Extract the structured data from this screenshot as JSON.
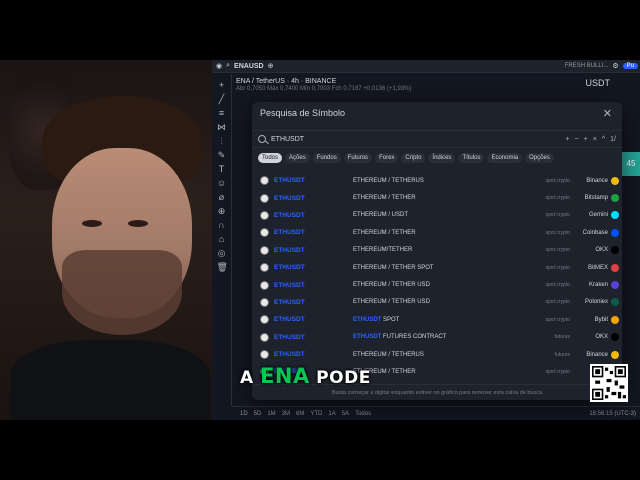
{
  "app": {
    "symbol": "ENAUSD",
    "chart_title": "ENA / TetherUS · 4h · BINANCE",
    "ohlc": "Abr 0,7050  Máx 0,7400  Mín 0,7003  Fch 0,7187 +0,0136 (+1,93%)",
    "fresh_label": "FRESH BULLI...",
    "publish_label": "Pu",
    "currency": "USDT",
    "price_tag": "45",
    "timeframes": [
      "1D",
      "5D",
      "1M",
      "3M",
      "6M",
      "YTD",
      "1A",
      "5A",
      "Todos"
    ],
    "clock": "18:56:15 (UTC-3)"
  },
  "modal": {
    "title": "Pesquisa de Símbolo",
    "search_value": "ETHUSDT",
    "search_tools": [
      "+",
      "−",
      "+",
      "×",
      "^",
      "1/"
    ],
    "tabs": [
      "Todos",
      "Ações",
      "Fundos",
      "Futuros",
      "Forex",
      "Cripto",
      "Índices",
      "Títulos",
      "Economia",
      "Opções"
    ],
    "rows": [
      {
        "symbol": "ETHUSDT",
        "desc": "ETHEREUM / TETHERUS",
        "type": "spot crypto",
        "exchange": "Binance",
        "ecolor": "#f0b90b"
      },
      {
        "symbol": "ETHUSDT",
        "desc": "ETHEREUM / TETHER",
        "type": "spot crypto",
        "exchange": "Bitstamp",
        "ecolor": "#1aa33e"
      },
      {
        "symbol": "ETHUSDT",
        "desc": "ETHEREUM / USDT",
        "type": "spot crypto",
        "exchange": "Gemini",
        "ecolor": "#00dcfa"
      },
      {
        "symbol": "ETHUSDT",
        "desc": "ETHEREUM / TETHER",
        "type": "spot crypto",
        "exchange": "Coinbase",
        "ecolor": "#0052ff"
      },
      {
        "symbol": "ETHUSDT",
        "desc": "ETHEREUM/TETHER",
        "type": "spot crypto",
        "exchange": "OKX",
        "ecolor": "#000000"
      },
      {
        "symbol": "ETHUSDT",
        "desc": "ETHEREUM / TETHER SPOT",
        "type": "spot crypto",
        "exchange": "BitMEX",
        "ecolor": "#e04040"
      },
      {
        "symbol": "ETHUSDT",
        "desc": "ETHEREUM / TETHER USD",
        "type": "spot crypto",
        "exchange": "Kraken",
        "ecolor": "#5741d9"
      },
      {
        "symbol": "ETHUSDT",
        "desc": "ETHEREUM / TETHER USD",
        "type": "spot crypto",
        "exchange": "Poloniex",
        "ecolor": "#0c5c4c"
      },
      {
        "symbol": "ETHUSDT",
        "desc_hl": "ETHUSDT",
        "desc": " SPOT",
        "type": "spot crypto",
        "exchange": "Bybit",
        "ecolor": "#f7a600"
      },
      {
        "symbol": "ETHUSDT",
        "desc_hl": "ETHUSDT",
        "desc": " FUTURES CONTRACT",
        "type": "futures",
        "exchange": "OKX",
        "ecolor": "#000000"
      },
      {
        "symbol": "ETHUSDT",
        "desc": "ETHEREUM / TETHERUS",
        "type": "futures",
        "exchange": "Binance",
        "ecolor": "#f0b90b"
      },
      {
        "symbol": "ETHUSDT",
        "desc": "ETHEREUM / TETHER",
        "type": "spot crypto",
        "exchange": "Huobi",
        "ecolor": "#2a6ad6"
      }
    ],
    "footer": "Basta começar a digitar enquanto estiver no gráfico para remover esta caixa de busca"
  },
  "caption": {
    "before": "A ",
    "highlight": "ENA",
    "after": " PODE"
  }
}
